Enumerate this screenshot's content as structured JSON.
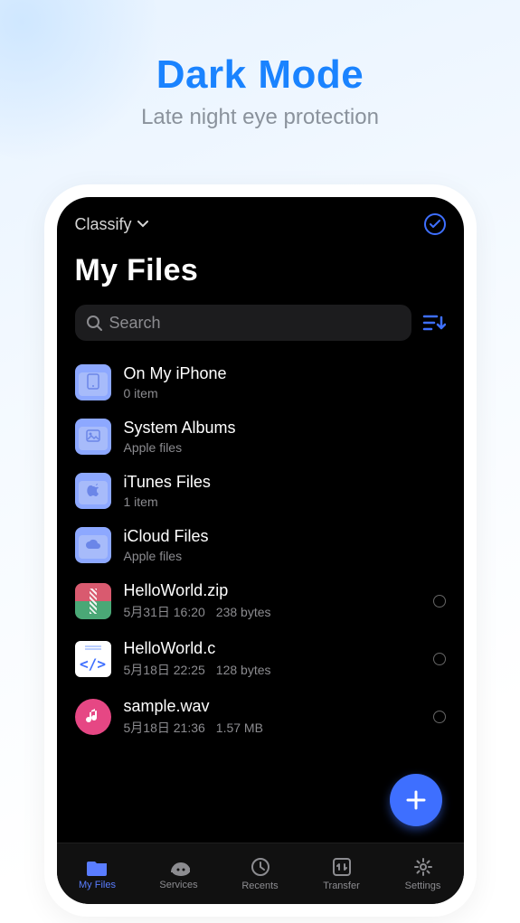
{
  "promo": {
    "title": "Dark Mode",
    "subtitle": "Late night eye protection"
  },
  "topbar": {
    "classify": "Classify"
  },
  "page_title": "My Files",
  "search": {
    "placeholder": "Search"
  },
  "items": [
    {
      "icon": "folder-phone",
      "title": "On My iPhone",
      "sub1": "0 item",
      "sub2": "",
      "selectable": false
    },
    {
      "icon": "folder-albums",
      "title": "System Albums",
      "sub1": "Apple files",
      "sub2": "",
      "selectable": false
    },
    {
      "icon": "folder-apple",
      "title": "iTunes Files",
      "sub1": "1 item",
      "sub2": "",
      "selectable": false
    },
    {
      "icon": "folder-cloud",
      "title": "iCloud Files",
      "sub1": "Apple files",
      "sub2": "",
      "selectable": false
    },
    {
      "icon": "zip",
      "title": "HelloWorld.zip",
      "sub1": "5月31日 16:20",
      "sub2": "238 bytes",
      "selectable": true
    },
    {
      "icon": "code",
      "title": "HelloWorld.c",
      "sub1": "5月18日 22:25",
      "sub2": "128 bytes",
      "selectable": true
    },
    {
      "icon": "audio",
      "title": "sample.wav",
      "sub1": "5月18日 21:36",
      "sub2": "1.57 MB",
      "selectable": true
    }
  ],
  "tabs": [
    {
      "label": "My Files",
      "active": true
    },
    {
      "label": "Services",
      "active": false
    },
    {
      "label": "Recents",
      "active": false
    },
    {
      "label": "Transfer",
      "active": false
    },
    {
      "label": "Settings",
      "active": false
    }
  ]
}
